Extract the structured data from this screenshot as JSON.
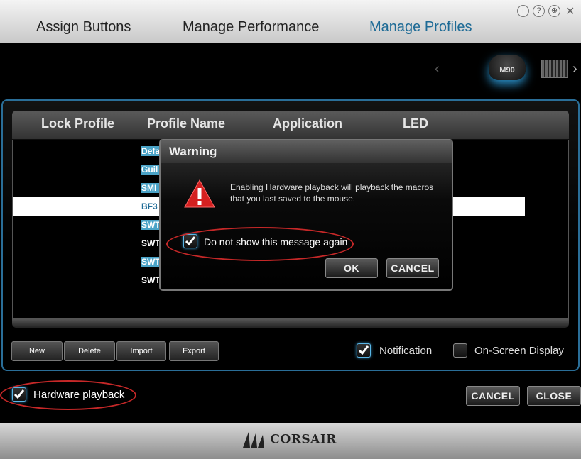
{
  "window": {
    "tabs": [
      "Assign Buttons",
      "Manage Performance",
      "Manage Profiles"
    ],
    "active_tab": "Manage Profiles",
    "window_icons": [
      "info-icon",
      "help-icon",
      "globe-icon",
      "close-icon"
    ]
  },
  "devices": {
    "mouse_label": "M90",
    "prev_icon": "chevron-left-icon",
    "next_icon": "chevron-right-icon"
  },
  "profiles": {
    "columns": [
      "Lock Profile",
      "Profile Name",
      "Application",
      "LED"
    ],
    "rows": [
      "Defa",
      "Guil",
      "SMI",
      "BF3",
      "SWT",
      "SWT",
      "SWT",
      "SWT"
    ],
    "selected_row_index": 3,
    "buttons": {
      "new": "New",
      "delete": "Delete",
      "import": "Import",
      "export": "Export"
    },
    "notification": {
      "label": "Notification",
      "checked": true
    },
    "osd": {
      "label": "On-Screen Display",
      "checked": false
    }
  },
  "hardware_playback": {
    "label": "Hardware playback",
    "checked": true
  },
  "footer_buttons": {
    "cancel": "CANCEL",
    "close": "CLOSE"
  },
  "brand": "CORSAIR",
  "dialog": {
    "title": "Warning",
    "message": "Enabling Hardware playback will playback the macros that you last saved to the mouse.",
    "checkbox_label": "Do not show this message again",
    "checkbox_checked": true,
    "ok": "OK",
    "cancel": "CANCEL"
  },
  "colors": {
    "accent": "#2a6e98",
    "active_tab": "#1e6b96",
    "annotation_ring": "#c62828",
    "warning": "#d42020"
  }
}
